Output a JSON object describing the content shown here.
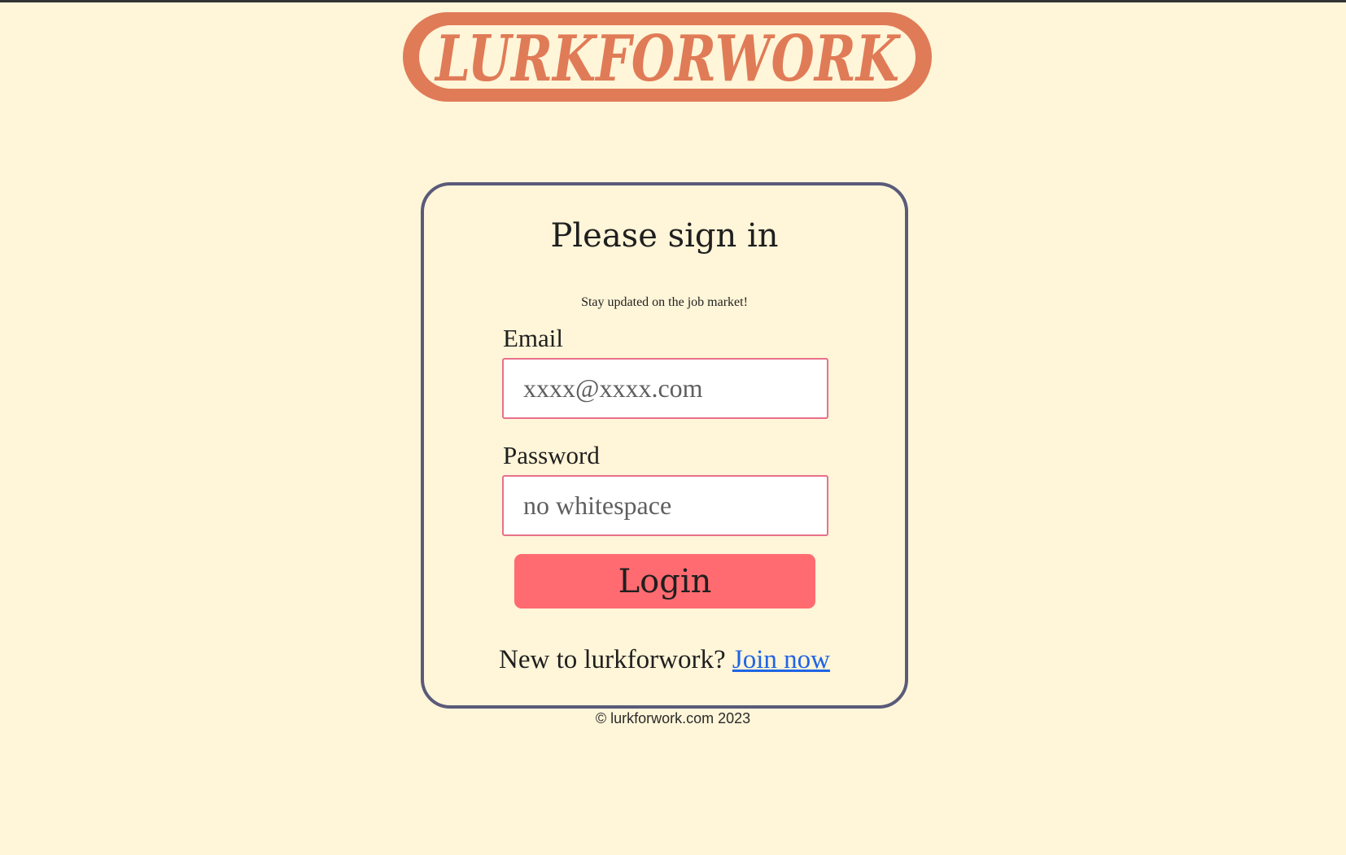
{
  "brand": {
    "logo_text": "LURKFORWORK",
    "logo_color": "#e07b57",
    "logo_fill": "#fff5d8"
  },
  "signin": {
    "title": "Please sign in",
    "subtitle": "Stay updated on the job market!",
    "email_label": "Email",
    "email_placeholder": "xxxx@xxxx.com",
    "email_value": "",
    "password_label": "Password",
    "password_placeholder": "no whitespace",
    "password_value": "",
    "login_label": "Login",
    "new_user_text": "New to lurkforwork?",
    "join_link_text": "Join now"
  },
  "footer": {
    "copyright": "© lurkforwork.com 2023"
  },
  "colors": {
    "background": "#fff5d8",
    "card_border": "#5a5a7a",
    "input_border": "#e8708a",
    "button": "#ff6b70",
    "link": "#1f64e6"
  }
}
